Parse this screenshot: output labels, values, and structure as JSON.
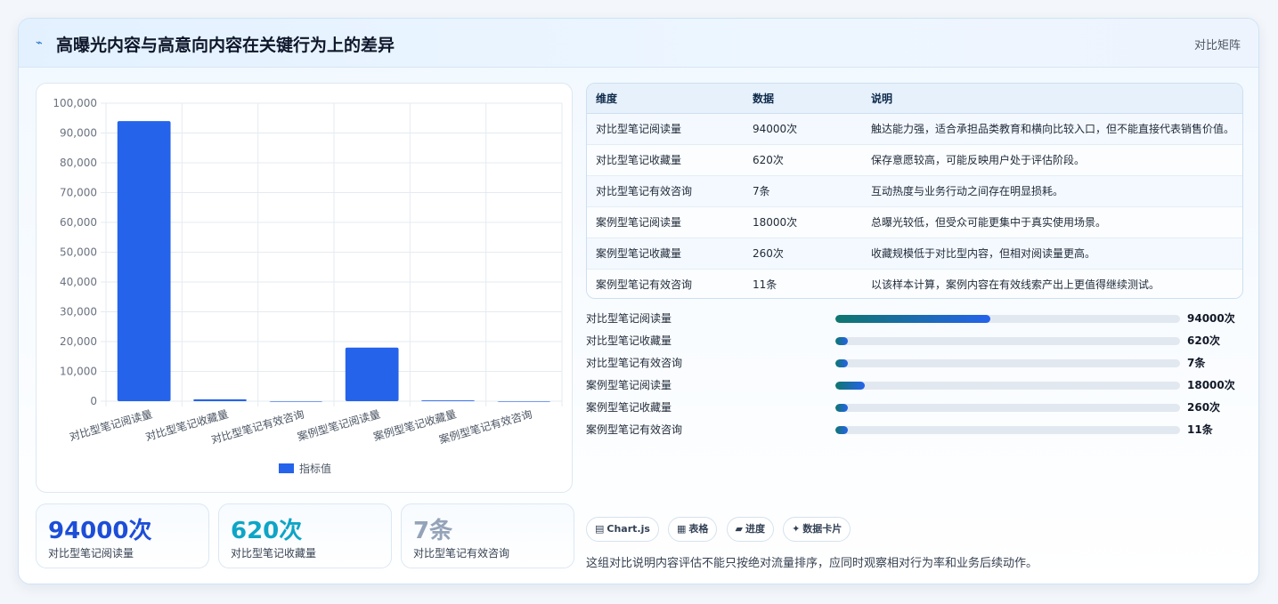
{
  "header": {
    "icon": "trend-icon",
    "title": "高曝光内容与高意向内容在关键行为上的差异",
    "tag": "对比矩阵"
  },
  "chart_data": {
    "type": "bar",
    "categories": [
      "对比型笔记阅读量",
      "对比型笔记收藏量",
      "对比型笔记有效咨询",
      "案例型笔记阅读量",
      "案例型笔记收藏量",
      "案例型笔记有效咨询"
    ],
    "series": [
      {
        "name": "指标值",
        "values": [
          94000,
          620,
          7,
          18000,
          260,
          11
        ]
      }
    ],
    "ylim": [
      0,
      100000
    ],
    "yticks": [
      "0",
      "10,000",
      "20,000",
      "30,000",
      "40,000",
      "50,000",
      "60,000",
      "70,000",
      "80,000",
      "90,000",
      "100,000"
    ],
    "grid": true,
    "legend": "bottom",
    "color": "#2563eb"
  },
  "stats": [
    {
      "value": "94000次",
      "label": "对比型笔记阅读量",
      "color": "#1d4ed8"
    },
    {
      "value": "620次",
      "label": "对比型笔记收藏量",
      "color": "#0ea5c6"
    },
    {
      "value": "7条",
      "label": "对比型笔记有效咨询",
      "color": "#94a3b8"
    }
  ],
  "table": {
    "headers": [
      "维度",
      "数据",
      "说明"
    ],
    "rows": [
      [
        "对比型笔记阅读量",
        "94000次",
        "触达能力强，适合承担品类教育和横向比较入口，但不能直接代表销售价值。"
      ],
      [
        "对比型笔记收藏量",
        "620次",
        "保存意愿较高，可能反映用户处于评估阶段。"
      ],
      [
        "对比型笔记有效咨询",
        "7条",
        "互动热度与业务行动之间存在明显损耗。"
      ],
      [
        "案例型笔记阅读量",
        "18000次",
        "总曝光较低，但受众可能更集中于真实使用场景。"
      ],
      [
        "案例型笔记收藏量",
        "260次",
        "收藏规模低于对比型内容，但相对阅读量更高。"
      ],
      [
        "案例型笔记有效咨询",
        "11条",
        "以该样本计算，案例内容在有效线索产出上更值得继续测试。"
      ]
    ]
  },
  "progress": [
    {
      "label": "对比型笔记阅读量",
      "value": "94000次",
      "fraction": 0.45
    },
    {
      "label": "对比型笔记收藏量",
      "value": "620次",
      "fraction": 0.03
    },
    {
      "label": "对比型笔记有效咨询",
      "value": "7条",
      "fraction": 0.03
    },
    {
      "label": "案例型笔记阅读量",
      "value": "18000次",
      "fraction": 0.085
    },
    {
      "label": "案例型笔记收藏量",
      "value": "260次",
      "fraction": 0.03
    },
    {
      "label": "案例型笔记有效咨询",
      "value": "11条",
      "fraction": 0.03
    }
  ],
  "chips": [
    {
      "icon": "chart-icon",
      "glyph": "▤",
      "label": "Chart.js"
    },
    {
      "icon": "table-icon",
      "glyph": "▦",
      "label": "表格"
    },
    {
      "icon": "progress-icon",
      "glyph": "▰",
      "label": "进度"
    },
    {
      "icon": "card-icon",
      "glyph": "✦",
      "label": "数据卡片"
    }
  ],
  "footnote": "这组对比说明内容评估不能只按绝对流量排序，应同时观察相对行为率和业务后续动作。"
}
